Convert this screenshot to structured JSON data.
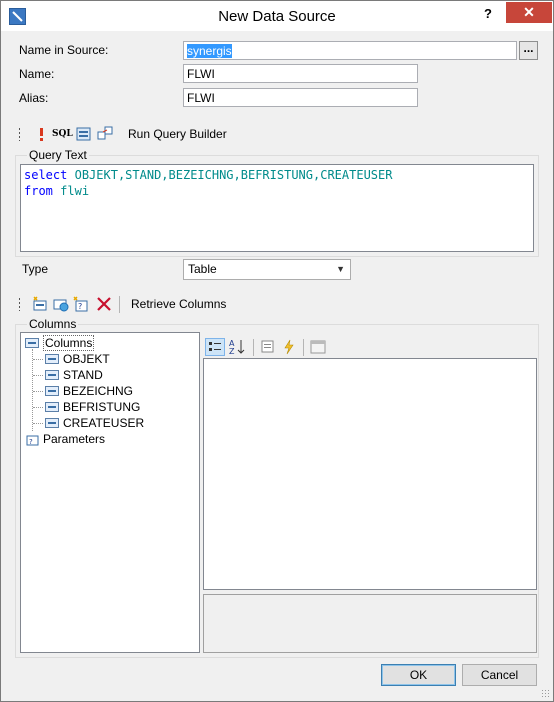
{
  "window": {
    "title": "New Data Source",
    "help": "?",
    "close": "✕"
  },
  "form": {
    "name_in_source_label": "Name in Source:",
    "name_in_source_value": "synergis",
    "ellipsis": "...",
    "name_label": "Name:",
    "name_value": "FLWI",
    "alias_label": "Alias:",
    "alias_value": "FLWI"
  },
  "query_toolbar": {
    "sql_label": "SQL",
    "run_query_builder": "Run Query Builder"
  },
  "query": {
    "group_title": "Query Text",
    "line1_keyword": "select",
    "line1_columns": "OBJEKT,STAND,BEZEICHNG,BEFRISTUNG,CREATEUSER",
    "line2_keyword": "from",
    "line2_table": "flwi"
  },
  "type": {
    "label": "Type",
    "value": "Table"
  },
  "columns_toolbar": {
    "retrieve_columns": "Retrieve Columns"
  },
  "columns": {
    "group_title": "Columns",
    "tree_root": "Columns",
    "items": [
      "OBJEKT",
      "STAND",
      "BEZEICHNG",
      "BEFRISTUNG",
      "CREATEUSER"
    ],
    "parameters": "Parameters"
  },
  "buttons": {
    "ok": "OK",
    "cancel": "Cancel"
  },
  "colors": {
    "accent": "#3399ff",
    "close": "#c7463a",
    "keyword": "#0000ff",
    "identifier": "#008b8b"
  }
}
